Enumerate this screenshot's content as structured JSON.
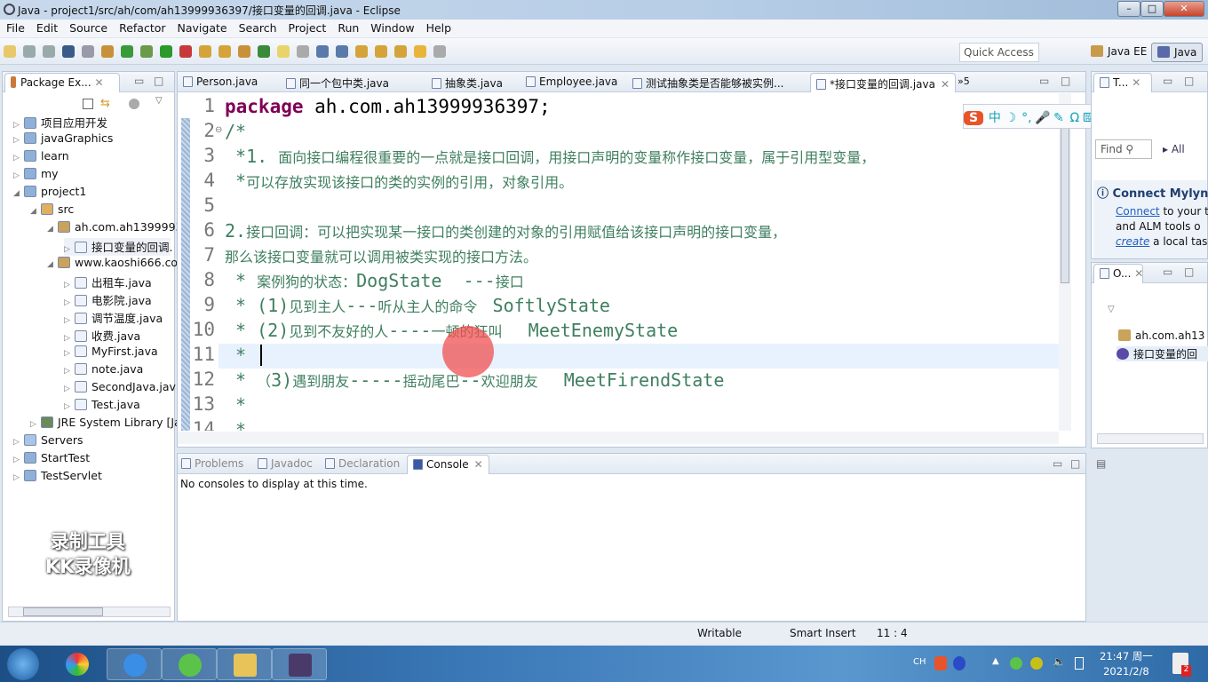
{
  "window": {
    "title": "Java - project1/src/ah/com/ah13999936397/接口变量的回调.java - Eclipse",
    "minimize": "–",
    "maximize": "□",
    "close": "✕"
  },
  "menu": [
    "File",
    "Edit",
    "Source",
    "Refactor",
    "Navigate",
    "Search",
    "Project",
    "Run",
    "Window",
    "Help"
  ],
  "toolbar": {
    "quick_access_placeholder": "Quick Access",
    "perspectives": [
      "Java EE",
      "Java"
    ]
  },
  "package_explorer": {
    "title": "Package Ex...",
    "tree": [
      {
        "label": "项目应用开发",
        "level": 0,
        "expanded": false,
        "icon": "project-icon"
      },
      {
        "label": "javaGraphics",
        "level": 0,
        "expanded": false,
        "icon": "project-icon"
      },
      {
        "label": "learn",
        "level": 0,
        "expanded": false,
        "icon": "project-icon"
      },
      {
        "label": "my",
        "level": 0,
        "expanded": false,
        "icon": "project-icon"
      },
      {
        "label": "project1",
        "level": 0,
        "expanded": true,
        "icon": "project-icon"
      },
      {
        "label": "src",
        "level": 1,
        "expanded": true,
        "icon": "source-folder-icon"
      },
      {
        "label": "ah.com.ah1399993",
        "level": 2,
        "expanded": true,
        "icon": "package-icon"
      },
      {
        "label": "接口变量的回调.",
        "level": 3,
        "expanded": false,
        "icon": "java-file-icon",
        "selected": true
      },
      {
        "label": "www.kaoshi666.co",
        "level": 2,
        "expanded": true,
        "icon": "package-icon"
      },
      {
        "label": "出租车.java",
        "level": 3,
        "expanded": false,
        "icon": "java-file-icon"
      },
      {
        "label": "电影院.java",
        "level": 3,
        "expanded": false,
        "icon": "java-file-icon"
      },
      {
        "label": "调节温度.java",
        "level": 3,
        "expanded": false,
        "icon": "java-file-icon"
      },
      {
        "label": "收费.java",
        "level": 3,
        "expanded": false,
        "icon": "java-file-icon"
      },
      {
        "label": "MyFirst.java",
        "level": 3,
        "expanded": false,
        "icon": "java-file-icon"
      },
      {
        "label": "note.java",
        "level": 3,
        "expanded": false,
        "icon": "java-file-icon"
      },
      {
        "label": "SecondJava.jav",
        "level": 3,
        "expanded": false,
        "icon": "java-file-icon"
      },
      {
        "label": "Test.java",
        "level": 3,
        "expanded": false,
        "icon": "java-file-icon"
      },
      {
        "label": "JRE System Library [Ja",
        "level": 1,
        "expanded": false,
        "icon": "library-icon"
      },
      {
        "label": "Servers",
        "level": 0,
        "expanded": false,
        "icon": "folder-icon"
      },
      {
        "label": "StartTest",
        "level": 0,
        "expanded": false,
        "icon": "project-icon"
      },
      {
        "label": "TestServlet",
        "level": 0,
        "expanded": false,
        "icon": "project-icon"
      }
    ]
  },
  "editor": {
    "tabs": [
      "Person.java",
      "同一个包中类.java",
      "抽象类.java",
      "Employee.java",
      "测试抽象类是否能够被实例...",
      "*接口变量的回调.java"
    ],
    "active_tab": 5,
    "overflow": "»5",
    "lines": [
      {
        "n": "1",
        "segs": [
          {
            "t": "package",
            "c": "kw"
          },
          {
            "t": " ah.com.ah13999936397;",
            "c": "pk"
          }
        ]
      },
      {
        "n": "2",
        "segs": [
          {
            "t": "/*",
            "c": "mono"
          }
        ]
      },
      {
        "n": "3",
        "segs": [
          {
            "t": " *1. ",
            "c": "mono"
          },
          {
            "t": "面向接口编程很重要的一点就是接口回调，用接口声明的变量称作接口变量，属于引用型变量，",
            "c": "cn"
          }
        ]
      },
      {
        "n": "4",
        "segs": [
          {
            "t": " *",
            "c": "mono"
          },
          {
            "t": "可以存放实现该接口的类的实例的引用，对象引用。",
            "c": "cn"
          }
        ]
      },
      {
        "n": "5",
        "segs": []
      },
      {
        "n": "6",
        "segs": [
          {
            "t": "2.",
            "c": "mono"
          },
          {
            "t": "接口回调：可以把实现某一接口的类创建的对象的引用赋值给该接口声明的接口变量，",
            "c": "cn"
          }
        ]
      },
      {
        "n": "7",
        "segs": [
          {
            "t": "那么该接口变量就可以调用被类实现的接口方法。",
            "c": "cn"
          }
        ]
      },
      {
        "n": "8",
        "segs": [
          {
            "t": " * ",
            "c": "mono"
          },
          {
            "t": "案例狗的状态：",
            "c": "cn"
          },
          {
            "t": "DogState  ---",
            "c": "mono"
          },
          {
            "t": "接口",
            "c": "cn"
          }
        ]
      },
      {
        "n": "9",
        "segs": [
          {
            "t": " * (1)",
            "c": "mono"
          },
          {
            "t": "见到主人",
            "c": "cn"
          },
          {
            "t": "---",
            "c": "mono"
          },
          {
            "t": "听从主人的命令 ",
            "c": "cn"
          },
          {
            "t": " SoftlyState",
            "c": "mono"
          }
        ]
      },
      {
        "n": "10",
        "segs": [
          {
            "t": " * (2)",
            "c": "mono"
          },
          {
            "t": "见到不友好的人",
            "c": "cn"
          },
          {
            "t": "----",
            "c": "mono"
          },
          {
            "t": "一顿的狂叫 ",
            "c": "cn"
          },
          {
            "t": "  MeetEnemyState",
            "c": "mono"
          }
        ]
      },
      {
        "n": "11",
        "segs": [
          {
            "t": " *",
            "c": "mono"
          }
        ]
      },
      {
        "n": "12",
        "segs": [
          {
            "t": " * ",
            "c": "mono"
          },
          {
            "t": "（",
            "c": "cn"
          },
          {
            "t": "3)",
            "c": "mono"
          },
          {
            "t": "遇到朋友",
            "c": "cn"
          },
          {
            "t": "-----",
            "c": "mono"
          },
          {
            "t": "摇动尾巴",
            "c": "cn"
          },
          {
            "t": "--",
            "c": "mono"
          },
          {
            "t": "欢迎朋友 ",
            "c": "cn"
          },
          {
            "t": "  MeetFirendState",
            "c": "mono"
          }
        ]
      },
      {
        "n": "13",
        "segs": [
          {
            "t": " *",
            "c": "mono"
          }
        ]
      },
      {
        "n": "14",
        "segs": [
          {
            "t": " *",
            "c": "mono"
          }
        ]
      }
    ],
    "current_line": 11
  },
  "tasks_panel": {
    "title": "T...",
    "find_placeholder": "Find",
    "all_label": "All",
    "mylyn_title": "Connect Mylyn",
    "mylyn_link1": "Connect",
    "mylyn_text1": " to your t",
    "mylyn_text2": "and ALM tools o",
    "mylyn_link2": "create",
    "mylyn_text3": " a local tas"
  },
  "outline": {
    "title": "O...",
    "items": [
      "ah.com.ah13",
      "接口变量的回"
    ]
  },
  "bottom": {
    "tabs": [
      "Problems",
      "Javadoc",
      "Declaration",
      "Console"
    ],
    "active_tab": 3,
    "message": "No consoles to display at this time."
  },
  "status": {
    "writable": "Writable",
    "insert_mode": "Smart Insert",
    "position": "11 : 4"
  },
  "watermark": [
    "录制工具",
    "KK录像机"
  ],
  "ime": {
    "icons": [
      "中",
      "☽",
      "°,",
      "🎤",
      "✎",
      "Ω",
      "⌨",
      "👤",
      "👕",
      "▦"
    ]
  },
  "taskbar": {
    "lang": "CH",
    "time": "21:47 周一",
    "date": "2021/2/8",
    "badge": "2"
  },
  "colors": {
    "keyword": "#7f0055",
    "comment": "#3f7f5f",
    "line_highlight": "#e8f2fe",
    "accent": "#1f5fbf"
  }
}
